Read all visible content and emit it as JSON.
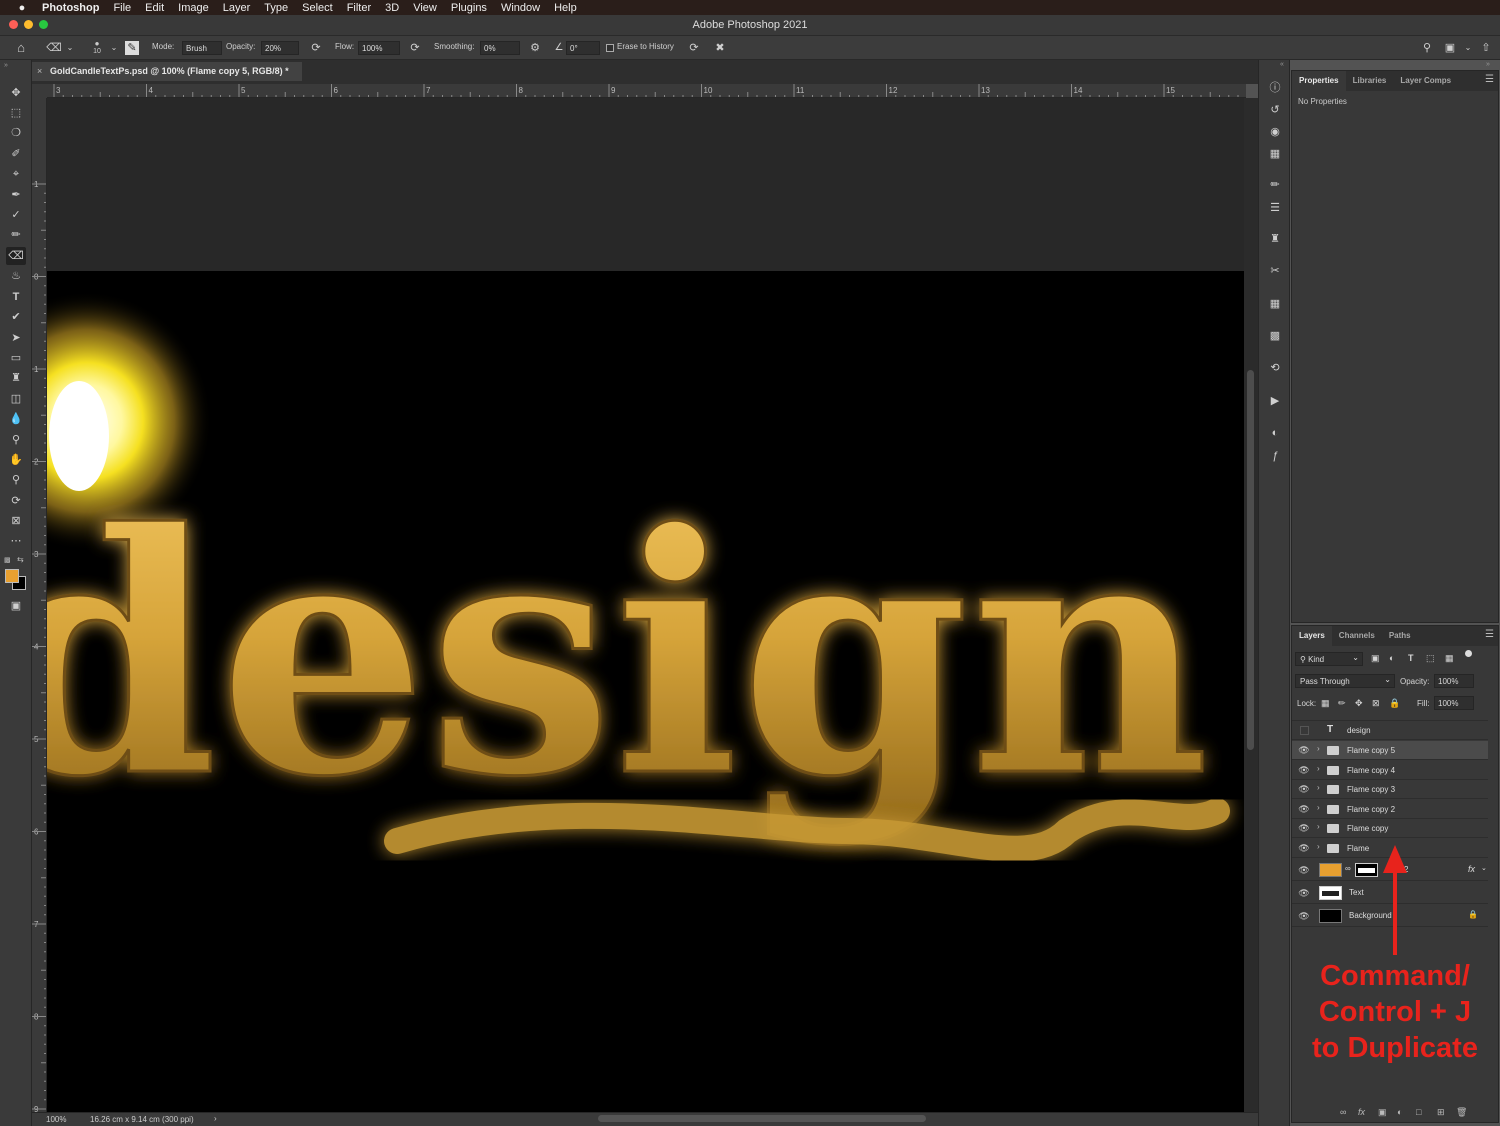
{
  "menubar": {
    "apple": "",
    "items": [
      "Photoshop",
      "File",
      "Edit",
      "Image",
      "Layer",
      "Type",
      "Select",
      "Filter",
      "3D",
      "View",
      "Plugins",
      "Window",
      "Help"
    ]
  },
  "window": {
    "title": "Adobe Photoshop 2021"
  },
  "options": {
    "brush_size": "10",
    "mode_label": "Mode:",
    "mode_value": "Brush",
    "opacity_label": "Opacity:",
    "opacity_value": "20%",
    "flow_label": "Flow:",
    "flow_value": "100%",
    "smoothing_label": "Smoothing:",
    "smoothing_value": "0%",
    "angle_value": "0°",
    "erase_history_label": "Erase to History"
  },
  "document": {
    "tab_title": "GoldCandleTextPs.psd @ 100% (Flame copy 5, RGB/8) *",
    "zoom": "100%",
    "doc_info": "16.26 cm x 9.14 cm (300 ppi)",
    "canvas_text": "design"
  },
  "ruler": {
    "h_ticks": [
      "3",
      "4",
      "5",
      "6",
      "7",
      "8",
      "9",
      "10",
      "11",
      "12",
      "13",
      "14",
      "15"
    ],
    "v_ticks": [
      "1",
      "0",
      "1",
      "2",
      "3",
      "4",
      "5",
      "6",
      "7",
      "8",
      "9"
    ]
  },
  "properties_panel": {
    "tabs": [
      "Properties",
      "Libraries",
      "Layer Comps"
    ],
    "empty_text": "No Properties"
  },
  "layers_panel": {
    "tabs": [
      "Layers",
      "Channels",
      "Paths"
    ],
    "filter_kind": "Kind",
    "blend_mode": "Pass Through",
    "opacity_label": "Opacity:",
    "opacity_value": "100%",
    "lock_label": "Lock:",
    "fill_label": "Fill:",
    "fill_value": "100%",
    "layers": [
      {
        "name": "design",
        "kind": "text"
      },
      {
        "name": "Flame copy 5",
        "kind": "group"
      },
      {
        "name": "Flame copy 4",
        "kind": "group"
      },
      {
        "name": "Flame copy 3",
        "kind": "group"
      },
      {
        "name": "Flame copy 2",
        "kind": "group"
      },
      {
        "name": "Flame copy",
        "kind": "group"
      },
      {
        "name": "Flame",
        "kind": "group"
      },
      {
        "name": "2",
        "kind": "fill"
      },
      {
        "name": "Text",
        "kind": "pixel"
      },
      {
        "name": "Background",
        "kind": "background"
      }
    ]
  },
  "annotation": {
    "line1": "Command/",
    "line2": "Control + J",
    "line3": "to Duplicate",
    "color": "#e8231c"
  },
  "colors": {
    "foreground": "#e8a030",
    "background": "#000000",
    "gold": "#d8a93c"
  }
}
